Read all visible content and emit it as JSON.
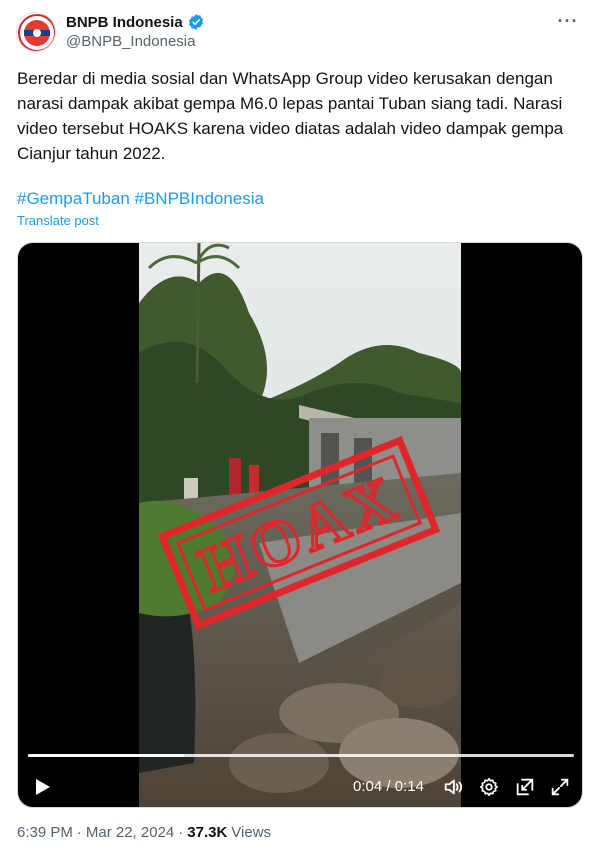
{
  "account": {
    "display_name": "BNPB Indonesia",
    "handle": "@BNPB_Indonesia",
    "verified": true,
    "avatar_icon": "bnpb-logo-icon"
  },
  "tweet": {
    "text": "Beredar di media sosial dan WhatsApp Group video kerusakan dengan narasi dampak akibat gempa M6.0 lepas pantai Tuban siang tadi. Narasi video tersebut HOAKS karena video diatas adalah video dampak gempa Cianjur tahun 2022.",
    "hashtags": [
      "#GempaTuban",
      "#BNPBIndonesia"
    ],
    "translate_label": "Translate post"
  },
  "media": {
    "overlay_stamp": "HOAX",
    "current_time": "0:04",
    "separator": "/",
    "duration": "0:14",
    "progress": 0.286
  },
  "footer": {
    "time": "6:39 PM",
    "dot1": "·",
    "date": "Mar 22, 2024",
    "dot2": "·",
    "views_count": "37.3K",
    "views_label": "Views"
  },
  "colors": {
    "accent": "#1d9bf0",
    "verified": "#1d9bf0",
    "stamp": "#e0262b"
  }
}
